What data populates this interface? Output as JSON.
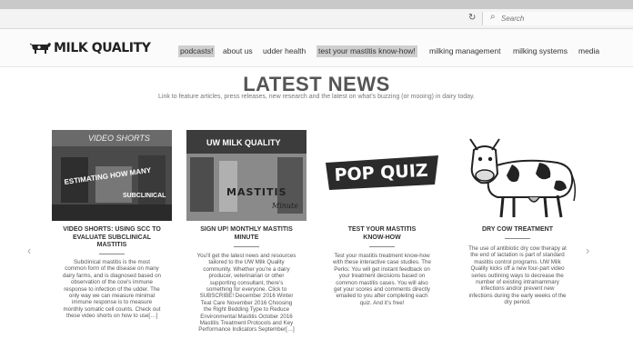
{
  "browser": {
    "search_placeholder": "Search"
  },
  "site": {
    "logo_text": "MILK QUALITY"
  },
  "nav": [
    {
      "label": "podcasts!",
      "highlighted": true
    },
    {
      "label": "about us",
      "highlighted": false
    },
    {
      "label": "udder health",
      "highlighted": false
    },
    {
      "label": "test your mastitis know-how!",
      "highlighted": true
    },
    {
      "label": "milking management",
      "highlighted": false
    },
    {
      "label": "milking systems",
      "highlighted": false
    },
    {
      "label": "media",
      "highlighted": false
    }
  ],
  "hero": {
    "title": "LATEST NEWS",
    "subtitle": "Link to feature articles, press releases, new research and the latest on what’s buzzing (or mooing) in dairy today."
  },
  "cards": [
    {
      "title_lines": [
        "VIDEO SHORTS: USING SCC TO",
        "EVALUATE SUBCLINICAL",
        "MASTITIS"
      ],
      "image_text": [
        "VIDEO SHORTS",
        "ESTIMATING HOW MANY",
        "SUBCLINICAL"
      ],
      "body_lines": [
        "Subclinical mastitis is the most",
        "common form of the disease on many",
        "dairy farms, and is diagnosed based on",
        "observation of the cow’s immune",
        "response to infection of the udder. The",
        "only way we can measure minimal",
        "immune response is to measure",
        "monthly somatic cell counts. Check out",
        "these video shorts on how to use[…]"
      ]
    },
    {
      "title_lines": [
        "SIGN UP! MONTHLY MASTITIS",
        "MINUTE"
      ],
      "image_text": [
        "UW MILK QUALITY",
        "MASTITIS",
        "Minute"
      ],
      "body_lines": [
        "You’ll get the latest news and resources",
        "tailored to the UW Milk Quality",
        "community. Whether you’re a dairy",
        "producer, veterinarian or other",
        "supporting consultant, there’s",
        "something for everyone. Click to",
        "SUBSCRIBE! December 2016 Winter",
        "Teat Care November 2016 Choosing",
        "the Right Bedding Type to Reduce",
        "Environmental Mastitis October 2016",
        "Mastitis Treatment Protocols and Key",
        "Performance Indicators September[…]"
      ]
    },
    {
      "title_lines": [
        "TEST YOUR MASTITIS",
        "KNOW-HOW"
      ],
      "image_text": [
        "POP QUIZ"
      ],
      "body_lines": [
        "Test your mastitis treatment know-how",
        "with these interactive case studies. The",
        "Perks: You will get instant feedback on",
        "your treatment decisions based on",
        "common mastitis cases. You will also",
        "get your scores and comments directly",
        "emailed to you after completing each",
        "quiz. And it’s free!"
      ]
    },
    {
      "title_lines": [
        "DRY COW TREATMENT"
      ],
      "image_text": [],
      "body_lines": [
        "The use of antibiotic dry cow therapy at",
        "the end of lactation is part of standard",
        "mastitis control programs. UW Milk",
        "Quality kicks off a new four-part video",
        "series outlining ways to decrease the",
        "number of existing intramammary",
        "infections and/or prevent new",
        "infections during the early weeks of the",
        "dry period."
      ]
    }
  ],
  "carousel": {
    "prev_icon": "‹",
    "next_icon": "›"
  }
}
